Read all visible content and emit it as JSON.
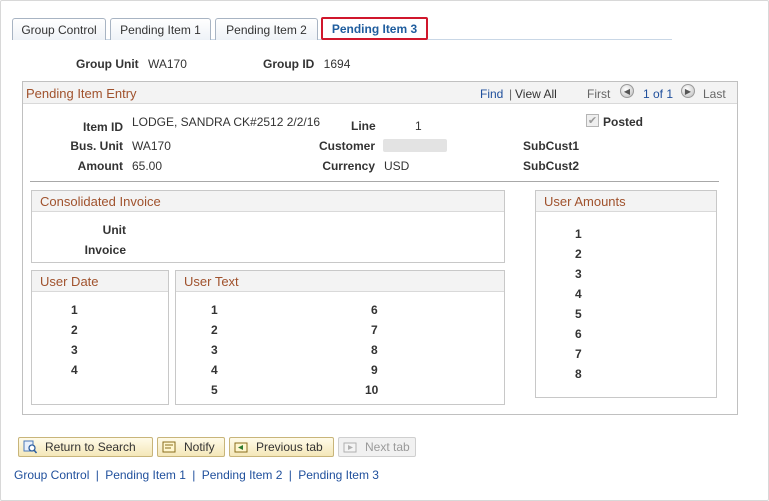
{
  "tabs": [
    {
      "label": "Group Control",
      "active": false
    },
    {
      "label": "Pending Item 1",
      "active": false
    },
    {
      "label": "Pending Item 2",
      "active": false
    },
    {
      "label": "Pending Item 3",
      "active": true
    }
  ],
  "header": {
    "group_unit_label": "Group Unit",
    "group_unit_value": "WA170",
    "group_id_label": "Group ID",
    "group_id_value": "1694"
  },
  "entry": {
    "title": "Pending Item Entry",
    "find": "Find",
    "sep": "|",
    "view_all": "View All",
    "first": "First",
    "page": "1 of 1",
    "last": "Last",
    "item_id_label": "Item ID",
    "item_id_value": "LODGE, SANDRA CK#2512 2/2/16",
    "line_label": "Line",
    "line_value": "1",
    "posted_label": "Posted",
    "posted_checked": true,
    "bus_unit_label": "Bus. Unit",
    "bus_unit_value": "WA170",
    "customer_label": "Customer",
    "subcust1_label": "SubCust1",
    "amount_label": "Amount",
    "amount_value": "65.00",
    "currency_label": "Currency",
    "currency_value": "USD",
    "subcust2_label": "SubCust2"
  },
  "consolidated": {
    "title": "Consolidated Invoice",
    "unit_label": "Unit",
    "invoice_label": "Invoice"
  },
  "user_amounts": {
    "title": "User Amounts",
    "numbers": [
      "1",
      "2",
      "3",
      "4",
      "5",
      "6",
      "7",
      "8"
    ]
  },
  "user_date": {
    "title": "User Date",
    "numbers": [
      "1",
      "2",
      "3",
      "4"
    ]
  },
  "user_text": {
    "title": "User Text",
    "left_numbers": [
      "1",
      "2",
      "3",
      "4",
      "5"
    ],
    "right_numbers": [
      "6",
      "7",
      "8",
      "9",
      "10"
    ]
  },
  "buttons": {
    "return": "Return to Search",
    "notify": "Notify",
    "previous": "Previous tab",
    "next": "Next tab"
  },
  "footer": {
    "links": [
      "Group Control",
      "Pending Item 1",
      "Pending Item 2",
      "Pending Item 3"
    ],
    "sep": "|"
  },
  "colors": {
    "active_tab_border": "#d0172c",
    "section_title": "#a0522d",
    "link": "#1f4f9c"
  }
}
